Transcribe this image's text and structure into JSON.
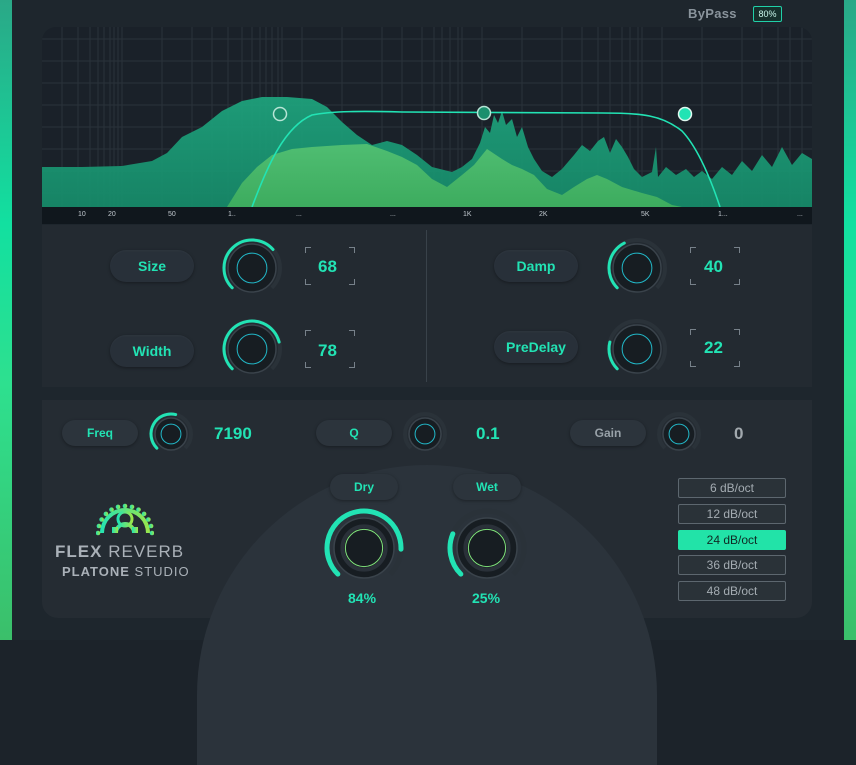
{
  "header": {
    "bypass_label": "ByPass",
    "bypass_value": "80%"
  },
  "analyzer": {
    "freq_ticks": [
      "10",
      "20",
      "50",
      "1..",
      "...",
      "...",
      "1K",
      "2K",
      "5K",
      "1...",
      "..."
    ]
  },
  "controls": {
    "size": {
      "label": "Size",
      "value": "68",
      "level": 0.68
    },
    "width": {
      "label": "Width",
      "value": "78",
      "level": 0.78
    },
    "damp": {
      "label": "Damp",
      "value": "40",
      "level": 0.4
    },
    "predelay": {
      "label": "PreDelay",
      "value": "22",
      "level": 0.22
    }
  },
  "eq": {
    "freq": {
      "label": "Freq",
      "value": "7190",
      "level": 0.55
    },
    "q": {
      "label": "Q",
      "value": "0.1",
      "level": 0.0
    },
    "gain": {
      "label": "Gain",
      "value": "0",
      "level": 0.0
    }
  },
  "mix": {
    "dry": {
      "label": "Dry",
      "value": "84%",
      "level": 0.84
    },
    "wet": {
      "label": "Wet",
      "value": "25%",
      "level": 0.25
    }
  },
  "slopes": [
    "6 dB/oct",
    "12 dB/oct",
    "24 dB/oct",
    "36 dB/oct",
    "48 dB/oct"
  ],
  "selected_slope": "24 dB/oct",
  "logo": {
    "name_bold": "FLEX",
    "name_light": "REVERB",
    "studio_bold": "PLATONE",
    "studio_light": "STUDIO"
  },
  "colors": {
    "accent": "#22e3b4",
    "active_slope": "#22e3a8",
    "background": "#1e262d"
  }
}
